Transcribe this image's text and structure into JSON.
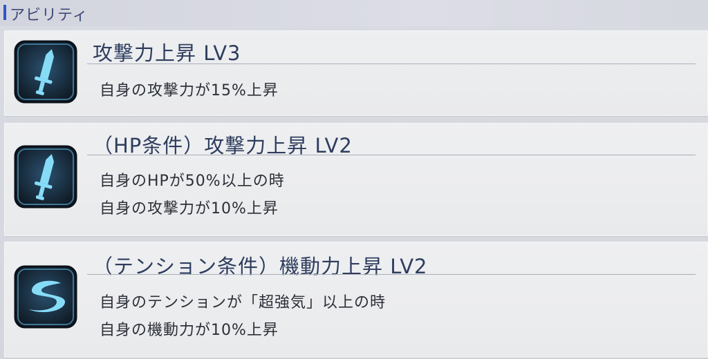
{
  "section": {
    "title": "アビリティ"
  },
  "abilities": [
    {
      "icon": "sword-icon",
      "name": "攻撃力上昇 LV3",
      "lines": [
        "自身の攻撃力が15%上昇"
      ]
    },
    {
      "icon": "sword-icon",
      "name": "（HP条件）攻撃力上昇 LV2",
      "lines": [
        "自身のHPが50%以上の時",
        "自身の攻撃力が10%上昇"
      ]
    },
    {
      "icon": "mobility-swoosh-icon",
      "name": "（テンション条件）機動力上昇 LV2",
      "lines": [
        "自身のテンションが「超強気」以上の時",
        "自身の機動力が10%上昇"
      ]
    }
  ],
  "colors": {
    "accent": "#2f56c9",
    "icon_frame": "#1b2c3c",
    "icon_glyph": "#7fd8f5"
  }
}
